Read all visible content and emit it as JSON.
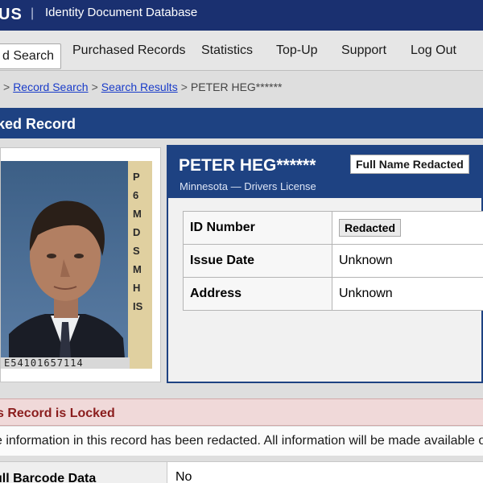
{
  "app": {
    "logo_text": "US",
    "separator": "|",
    "title": "Identity Document Database"
  },
  "nav": {
    "tabs": [
      {
        "label": "d Search"
      },
      {
        "label": "Purchased Records"
      },
      {
        "label": "Statistics"
      },
      {
        "label": "Top-Up"
      },
      {
        "label": "Support"
      },
      {
        "label": "Log Out"
      }
    ]
  },
  "breadcrumb": {
    "lead": ">",
    "items": [
      "Record Search",
      "Search Results"
    ],
    "current": "PETER HEG******",
    "separator": ">"
  },
  "section": {
    "title": "ked Record"
  },
  "id_card": {
    "side_letters": [
      "P",
      "6",
      "M",
      "D",
      "S",
      "M",
      "H",
      "",
      "IS"
    ],
    "number": "E5410165711​4"
  },
  "record": {
    "name": "PETER HEG******",
    "badge": "Full Name Redacted",
    "subtitle": "Minnesota — Drivers License",
    "fields": [
      {
        "label": "ID Number",
        "value": "Redacted",
        "is_badge": true
      },
      {
        "label": "Issue Date",
        "value": "Unknown",
        "is_badge": false
      },
      {
        "label": "Address",
        "value": "Unknown",
        "is_badge": false
      }
    ]
  },
  "lock": {
    "title": "s Record is Locked",
    "message": "e information in this record has been redacted. All information will be made available once"
  },
  "bottom": {
    "label": "ull Barcode Data",
    "value": "No"
  },
  "colors": {
    "header_navy": "#1a3070",
    "panel_blue": "#1e4282",
    "link_blue": "#1a3cc9",
    "lock_red": "#8a1d1d",
    "lock_bg": "#f0d9d9"
  }
}
